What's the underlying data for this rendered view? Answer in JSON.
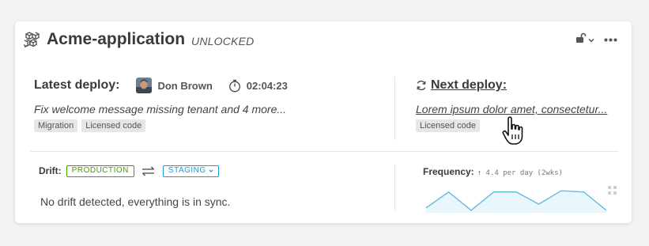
{
  "app": {
    "name": "Acme-application",
    "status": "UNLOCKED",
    "icons": {
      "app": "cubes-icon",
      "lock": "unlock-icon",
      "dropdown": "chevron-down-icon",
      "more": "more-horizontal-icon"
    }
  },
  "latest_deploy": {
    "label": "Latest deploy:",
    "user": "Don Brown",
    "duration": "02:04:23",
    "message": "Fix welcome message missing tenant and 4 more...",
    "tags": [
      "Migration",
      "Licensed code"
    ]
  },
  "next_deploy": {
    "label": "Next deploy:",
    "message": "Lorem ipsum dolor amet, consectetur...",
    "tags": [
      "Licensed code"
    ]
  },
  "drift": {
    "label": "Drift:",
    "source_env": "PRODUCTION",
    "target_env": "STAGING",
    "message": "No drift detected, everything is in sync."
  },
  "frequency": {
    "label": "Frequency:",
    "value": "4.4 per day (2wks)",
    "spark_values": [
      0.2,
      0.85,
      0.1,
      0.85,
      0.85,
      0.35,
      0.9,
      0.85,
      0.1
    ]
  },
  "colors": {
    "production": "#43a000",
    "staging": "#1b9bd8",
    "spark_line": "#5bb7df",
    "spark_fill": "#e9f6fc"
  }
}
